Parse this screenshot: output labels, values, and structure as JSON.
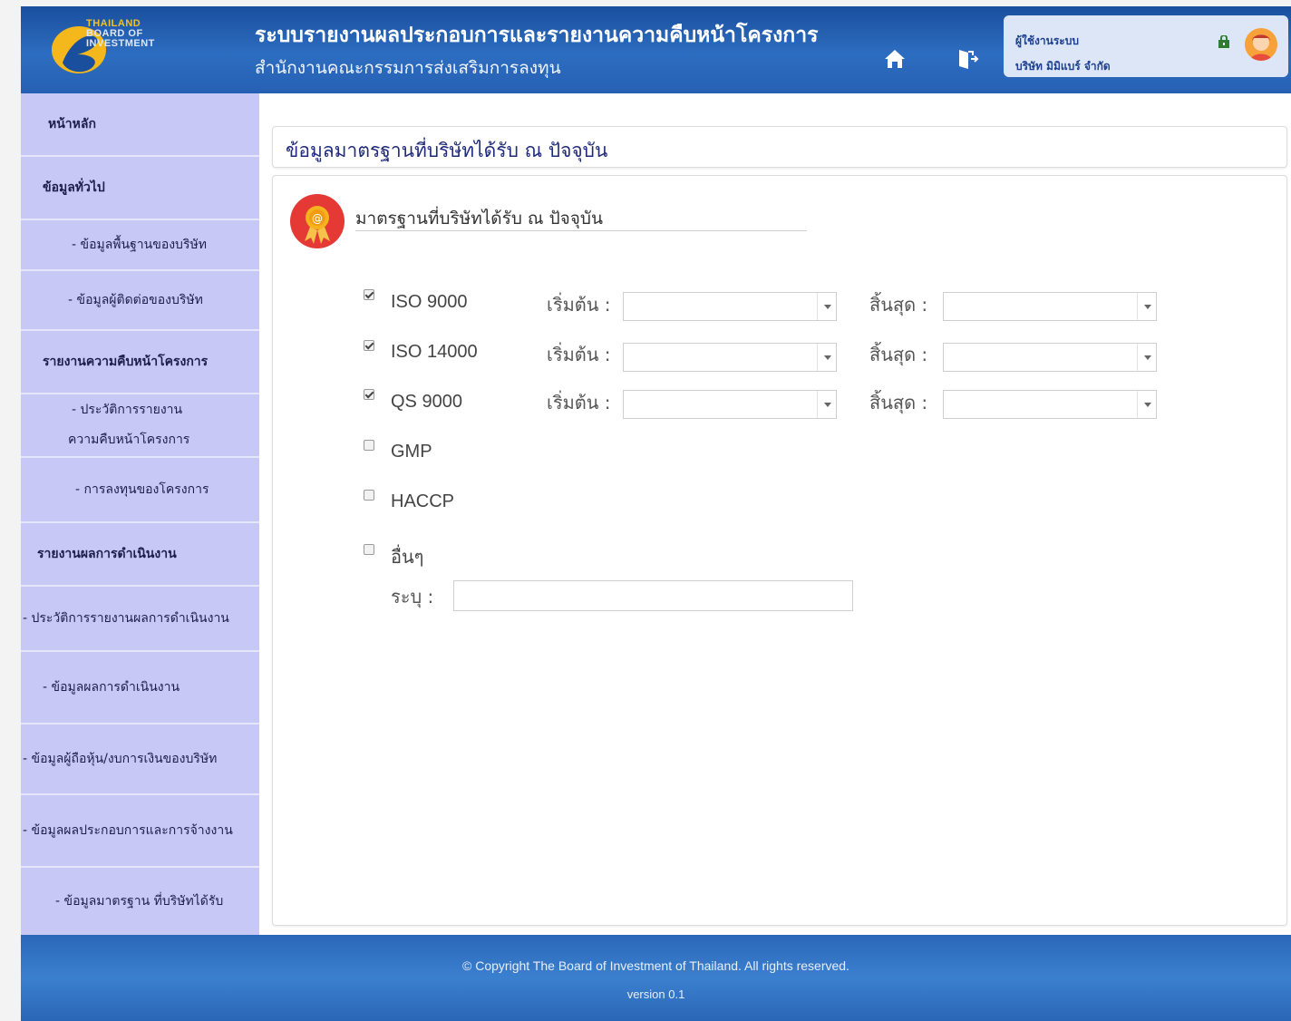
{
  "header": {
    "logo_lines": [
      "THAILAND",
      "BOARD OF",
      "INVESTMENT"
    ],
    "title": "ระบบรายงานผลประกอบการและรายงานความคืบหน้าโครงการ",
    "subtitle": "สำนักงานคณะกรรมการส่งเสริมการลงทุน",
    "icons": [
      "home-icon",
      "logout-icon"
    ],
    "user": {
      "role": "ผู้ใช้งานระบบ",
      "company": "บริษัท มิมิแบร์ จำกัด"
    }
  },
  "sidebar": {
    "items": [
      {
        "label": "หน้าหลัก"
      },
      {
        "label": "ข้อมูลทั่วไป"
      },
      {
        "label": "- ข้อมูลพื้นฐานของบริษัท"
      },
      {
        "label": "- ข้อมูลผู้ติดต่อของบริษัท"
      },
      {
        "label": "รายงานความคืบหน้าโครงการ"
      },
      {
        "label": "- ประวัติการรายงาน",
        "label2": "ความคืบหน้าโครงการ"
      },
      {
        "label": "- การลงทุนของโครงการ"
      },
      {
        "label": "รายงานผลการดำเนินงาน"
      },
      {
        "label": "- ประวัติการรายงานผลการดำเนินงาน"
      },
      {
        "label": "- ข้อมูลผลการดำเนินงาน"
      },
      {
        "label": "- ข้อมูลผู้ถือหุ้น/งบการเงินของบริษัท"
      },
      {
        "label": "- ข้อมูลผลประกอบการและการจ้างงาน"
      },
      {
        "label": "- ข้อมูลมาตรฐาน ที่บริษัทได้รับ"
      }
    ]
  },
  "main": {
    "page_title": "ข้อมูลมาตรฐานที่บริษัทได้รับ ณ ปัจจุบัน",
    "section_title": "มาตรฐานที่บริษัทได้รับ ณ ปัจจุบัน",
    "start_label": "เริ่มต้น :",
    "end_label": "สิ้นสุด :",
    "standards": [
      {
        "name": "ISO 9000",
        "checked": true
      },
      {
        "name": "ISO 14000",
        "checked": true
      },
      {
        "name": "QS 9000",
        "checked": true
      },
      {
        "name": "GMP",
        "checked": false
      },
      {
        "name": "HACCP",
        "checked": false
      },
      {
        "name": "อื่นๆ",
        "checked": false
      }
    ],
    "specify_label": "ระบุ :",
    "specify_value": ""
  },
  "footer": {
    "copyright": "© Copyright The Board of Investment of Thailand. All rights reserved.",
    "version": "version 0.1"
  }
}
